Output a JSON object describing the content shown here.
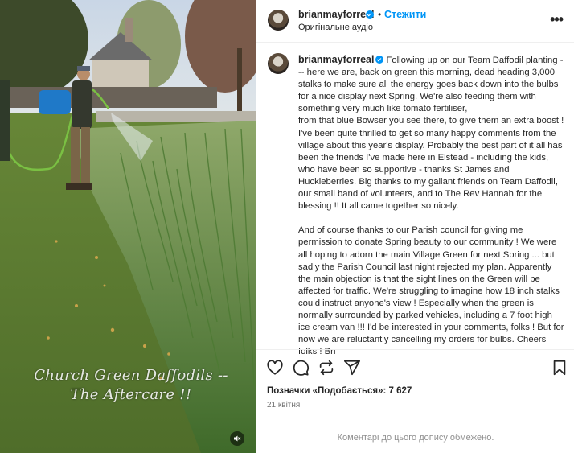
{
  "media": {
    "caption_line1": "Church Green Daffodils --",
    "caption_line2": "The Aftercare !!"
  },
  "header": {
    "username": "brianmayforreal",
    "separator": "•",
    "follow_label": "Стежити",
    "audio_label": "Оригінальне аудіо",
    "more_icon": "more-horizontal-icon"
  },
  "comment": {
    "username": "brianmayforreal",
    "text": "Following up on our Team Daffodil planting -\n-- here we are, back on green this morning, dead heading 3,000 stalks to make sure all the energy goes back down into the bulbs for a nice display next Spring. We're also feeding them with something very much like tomato fertiliser,\nfrom that blue Bowser you see there, to give them an extra boost ! I've been quite thrilled to get so many happy comments from the village about this year's display. Probably the best part of it all has been the friends I've made here in Elstead - including the kids, who have been so supportive - thanks St James and Huckleberries. Big thanks to my gallant friends on Team Daffodil, our small band of volunteers, and to The Rev Hannah for the blessing !! It all came together so nicely.\n\nAnd of course thanks to our Parish council for giving me permission to donate Spring beauty to our community ! We were all hoping to adorn the main Village Green for next Spring ... but sadly the Parish Council last night rejected my plan. Apparently the main objection is that the sight lines on the Green will be affected for traffic. We're struggling to imagine how 18 inch stalks could instruct anyone's view ! Especially when the green is normally surrounded by parked vehicles, including a 7 foot high ice cream van !!! I'd be interested in your comments, folks ! But for now we are reluctantly cancelling my orders for bulbs. Cheers folks ! Bri"
  },
  "actions": {
    "icons": [
      "heart-icon",
      "comment-icon",
      "repost-icon",
      "share-icon",
      "bookmark-icon"
    ],
    "likes_text": "Позначки «Подобається»: 7 627",
    "date_text": "21 квітня"
  },
  "footer": {
    "comments_disabled": "Коментарі до цього допису обмежено."
  },
  "colors": {
    "accent": "#0095f6",
    "text": "#262626",
    "muted": "#8e8e8e"
  }
}
